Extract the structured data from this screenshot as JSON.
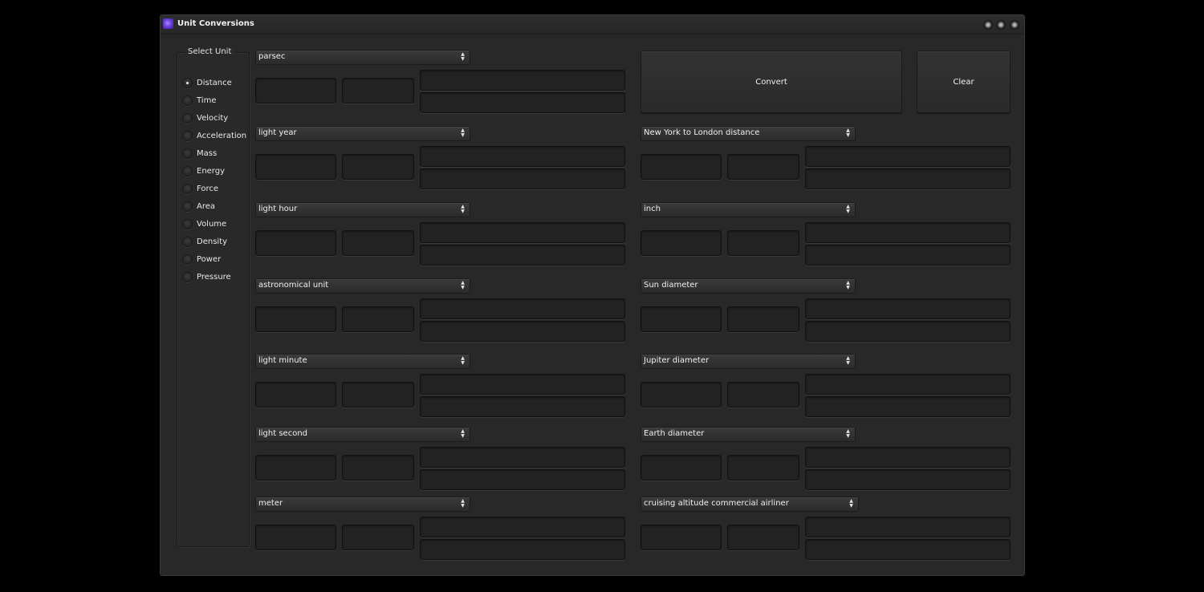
{
  "window": {
    "title": "Unit Conversions",
    "icon": "app-icon",
    "controls": [
      "minimize-button",
      "maximize-button",
      "close-button"
    ]
  },
  "unit_group": {
    "title": "Select Unit",
    "selected": "Distance",
    "options": [
      "Distance",
      "Time",
      "Velocity",
      "Acceleration",
      "Mass",
      "Energy",
      "Force",
      "Area",
      "Volume",
      "Density",
      "Power",
      "Pressure"
    ]
  },
  "actions": {
    "convert_label": "Convert",
    "clear_label": "Clear"
  },
  "left_rows": [
    {
      "unit": "parsec",
      "value": "",
      "exponent": "",
      "result_1": "",
      "result_2": ""
    },
    {
      "unit": "light year",
      "value": "",
      "exponent": "",
      "result_1": "",
      "result_2": ""
    },
    {
      "unit": "light hour",
      "value": "",
      "exponent": "",
      "result_1": "",
      "result_2": ""
    },
    {
      "unit": "astronomical unit",
      "value": "",
      "exponent": "",
      "result_1": "",
      "result_2": ""
    },
    {
      "unit": "light minute",
      "value": "",
      "exponent": "",
      "result_1": "",
      "result_2": ""
    },
    {
      "unit": "light second",
      "value": "",
      "exponent": "",
      "result_1": "",
      "result_2": ""
    },
    {
      "unit": "meter",
      "value": "",
      "exponent": "",
      "result_1": "",
      "result_2": ""
    }
  ],
  "right_rows": [
    {
      "unit": "New York to London distance",
      "value": "",
      "exponent": "",
      "result_1": "",
      "result_2": ""
    },
    {
      "unit": "inch",
      "value": "",
      "exponent": "",
      "result_1": "",
      "result_2": ""
    },
    {
      "unit": "Sun diameter",
      "value": "",
      "exponent": "",
      "result_1": "",
      "result_2": ""
    },
    {
      "unit": "Jupiter diameter",
      "value": "",
      "exponent": "",
      "result_1": "",
      "result_2": ""
    },
    {
      "unit": "Earth diameter",
      "value": "",
      "exponent": "",
      "result_1": "",
      "result_2": ""
    },
    {
      "unit": "cruising altitude commercial airliner",
      "value": "",
      "exponent": "",
      "result_1": "",
      "result_2": ""
    }
  ],
  "icons": {
    "select_arrows": "▲▼"
  }
}
